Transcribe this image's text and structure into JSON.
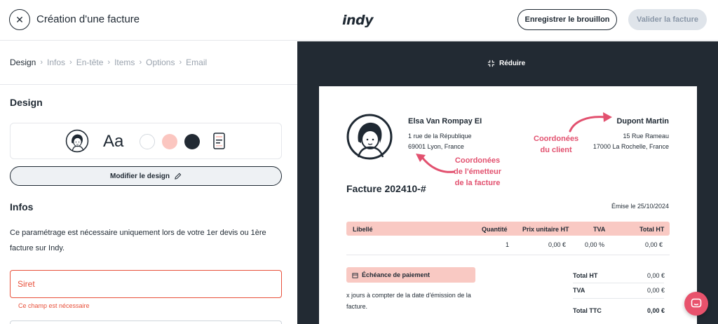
{
  "header": {
    "title": "Création d'une facture",
    "logo": "indy",
    "draft_label": "Enregistrer le brouillon",
    "validate_label": "Valider la facture"
  },
  "breadcrumb": [
    "Design",
    "Infos",
    "En-tête",
    "Items",
    "Options",
    "Email"
  ],
  "design_section": {
    "title": "Design",
    "font_sample": "Aa",
    "swatches": [
      "#ffffff",
      "#fbc6c0",
      "#222a33"
    ],
    "modify_label": "Modifier le design"
  },
  "infos_section": {
    "title": "Infos",
    "description": "Ce paramétrage est nécessaire uniquement lors de votre 1er devis ou 1ère facture sur Indy.",
    "siret_placeholder": "Siret",
    "siret_error": "Ce champ est nécessaire"
  },
  "preview": {
    "reduce_label": "Réduire",
    "issuer": {
      "name": "Elsa Van Rompay EI",
      "address_line1": "1 rue de la République",
      "address_line2": "69001 Lyon, France"
    },
    "client": {
      "name": "Dupont Martin",
      "address_line1": "15 Rue Rameau",
      "address_line2": "17000 La Rochelle, France"
    },
    "annotation_issuer": [
      "Coordonées",
      "de l'émetteur",
      "de la facture"
    ],
    "annotation_client": [
      "Coordonées",
      "du client"
    ],
    "invoice_title": "Facture 202410-#",
    "issue_date": "Émise le 25/10/2024",
    "table": {
      "headers": [
        "Libellé",
        "Quantité",
        "Prix unitaire HT",
        "TVA",
        "Total HT"
      ],
      "rows": [
        [
          "",
          "1",
          "0,00 €",
          "0,00 %",
          "0,00 €"
        ]
      ]
    },
    "payment": {
      "title": "Échéance de paiement",
      "text": "x jours à compter de la date d'émission de la facture."
    },
    "totals": [
      {
        "label": "Total HT",
        "value": "0,00 €"
      },
      {
        "label": "TVA",
        "value": "0,00 €"
      },
      {
        "label": "Total TTC",
        "value": "0,00 €"
      }
    ]
  },
  "colors": {
    "accent_pink": "#e2516f",
    "error_red": "#e8503a",
    "dark": "#222a33",
    "table_header": "#f9c9c3"
  }
}
